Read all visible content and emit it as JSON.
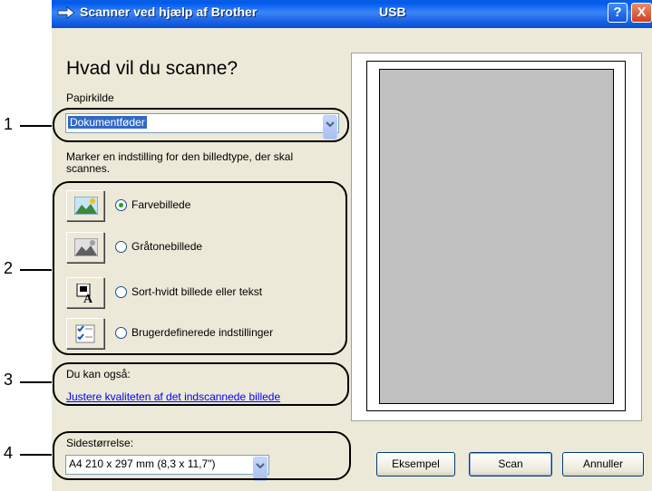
{
  "window": {
    "title": "Scanner ved hjælp af Brother",
    "connection": "USB",
    "help_glyph": "?",
    "close_glyph": "X"
  },
  "heading": "Hvad vil du scanne?",
  "paper_source": {
    "label": "Papirkilde",
    "value": "Dokumentføder"
  },
  "instruction": {
    "line1": "Marker en indstilling for den billedtype, der skal",
    "line2": "scannes."
  },
  "image_types": [
    {
      "label": "Farvebillede",
      "selected": true,
      "icon": "color-photo-icon"
    },
    {
      "label": "Gråtonebillede",
      "selected": false,
      "icon": "grayscale-photo-icon"
    },
    {
      "label": "Sort-hvidt billede eller tekst",
      "selected": false,
      "icon": "black-white-text-icon"
    },
    {
      "label": "Brugerdefinerede indstillinger",
      "selected": false,
      "icon": "custom-settings-icon"
    }
  ],
  "also": {
    "label": "Du kan også:",
    "link": "Justere kvaliteten af det indscannede billede"
  },
  "page_size": {
    "label": "Sidestørrelse:",
    "value": "A4 210 x 297 mm (8,3 x 11,7\")"
  },
  "buttons": {
    "preview": "Eksempel",
    "scan": "Scan",
    "cancel": "Annuller"
  },
  "callouts": [
    "1",
    "2",
    "3",
    "4"
  ]
}
